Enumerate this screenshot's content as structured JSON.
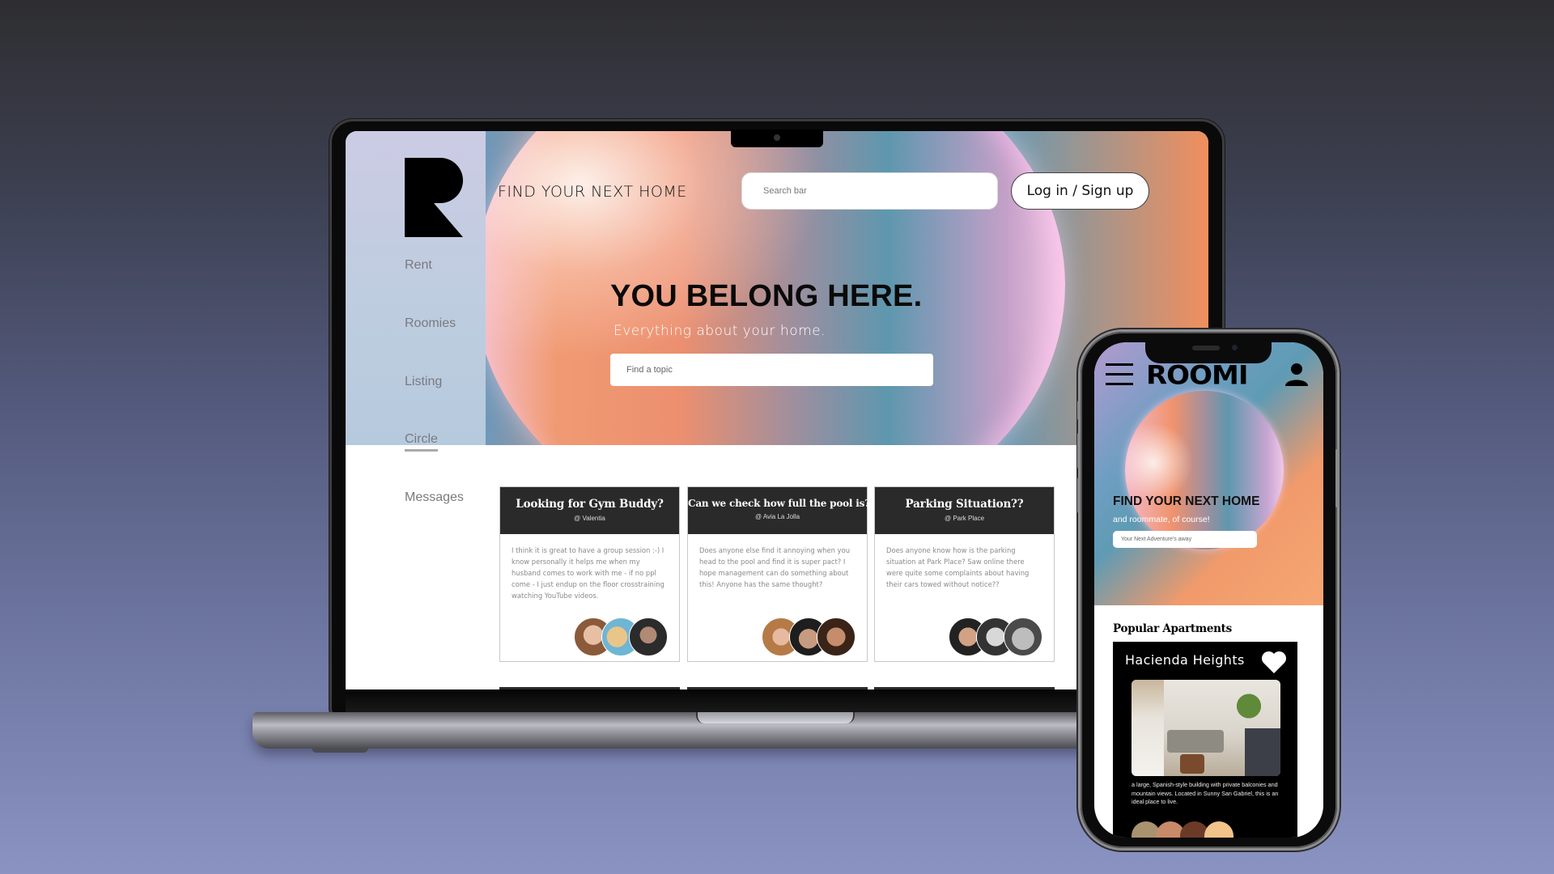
{
  "desktop": {
    "logo_letter": "R",
    "brand_tagline": "FIND YOUR NEXT HOME",
    "search": {
      "placeholder": "Search bar"
    },
    "login_button": "Log in / Sign up",
    "hero": {
      "title": "YOU BELONG HERE.",
      "subtitle": "Everything about your home.",
      "topic_input": {
        "placeholder": "Find a topic"
      }
    },
    "sidebar": {
      "items": [
        {
          "label": "Rent"
        },
        {
          "label": "Roomies"
        },
        {
          "label": "Listing"
        },
        {
          "label": "Circle",
          "active": true
        },
        {
          "label": "Messages"
        }
      ]
    },
    "posts": [
      {
        "title": "Looking for Gym Buddy?",
        "location": "@ Valentia",
        "body": "I think it is great to have a group session :-) I know personally it helps me when my husband comes to work with me - if no ppl come - I just endup on the floor crosstraining watching YouTube videos.",
        "avatar_count": 3
      },
      {
        "title": "Can we check how full the pool is?",
        "location": "@ Avia La Jolla",
        "body": "Does anyone else find it annoying when you head to the pool and find it is super pact? I hope management can do something about this! Anyone has the same thought?",
        "avatar_count": 3
      },
      {
        "title": "Parking Situation??",
        "location": "@ Park Place",
        "body": "Does anyone know how is the parking situation at Park Place? Saw online there were quite some complaints about having their cars towed without notice??",
        "avatar_count": 3
      }
    ]
  },
  "mobile": {
    "menu_icon": "hamburger-icon",
    "logo_text": "ROOMI",
    "user_icon": "user-icon",
    "hero": {
      "title": "FIND YOUR NEXT HOME",
      "subtitle": "and roommate, of course!",
      "input": {
        "placeholder": "Your Next Adventure's away"
      }
    },
    "section_title": "Popular Apartments",
    "featured": {
      "name": "Hacienda Heights",
      "favorite_icon": "heart-icon",
      "description": "a large, Spanish-style building with private balconies and mountain views. Located in Sunny San Gabriel, this is an ideal place to live.",
      "avatar_count": 4
    }
  },
  "colors": {
    "card_header": "#2a2a2a",
    "hero_orange": "#f19a75",
    "hero_teal": "#6999b0",
    "sidebar_lavender": "#cccbe4"
  }
}
